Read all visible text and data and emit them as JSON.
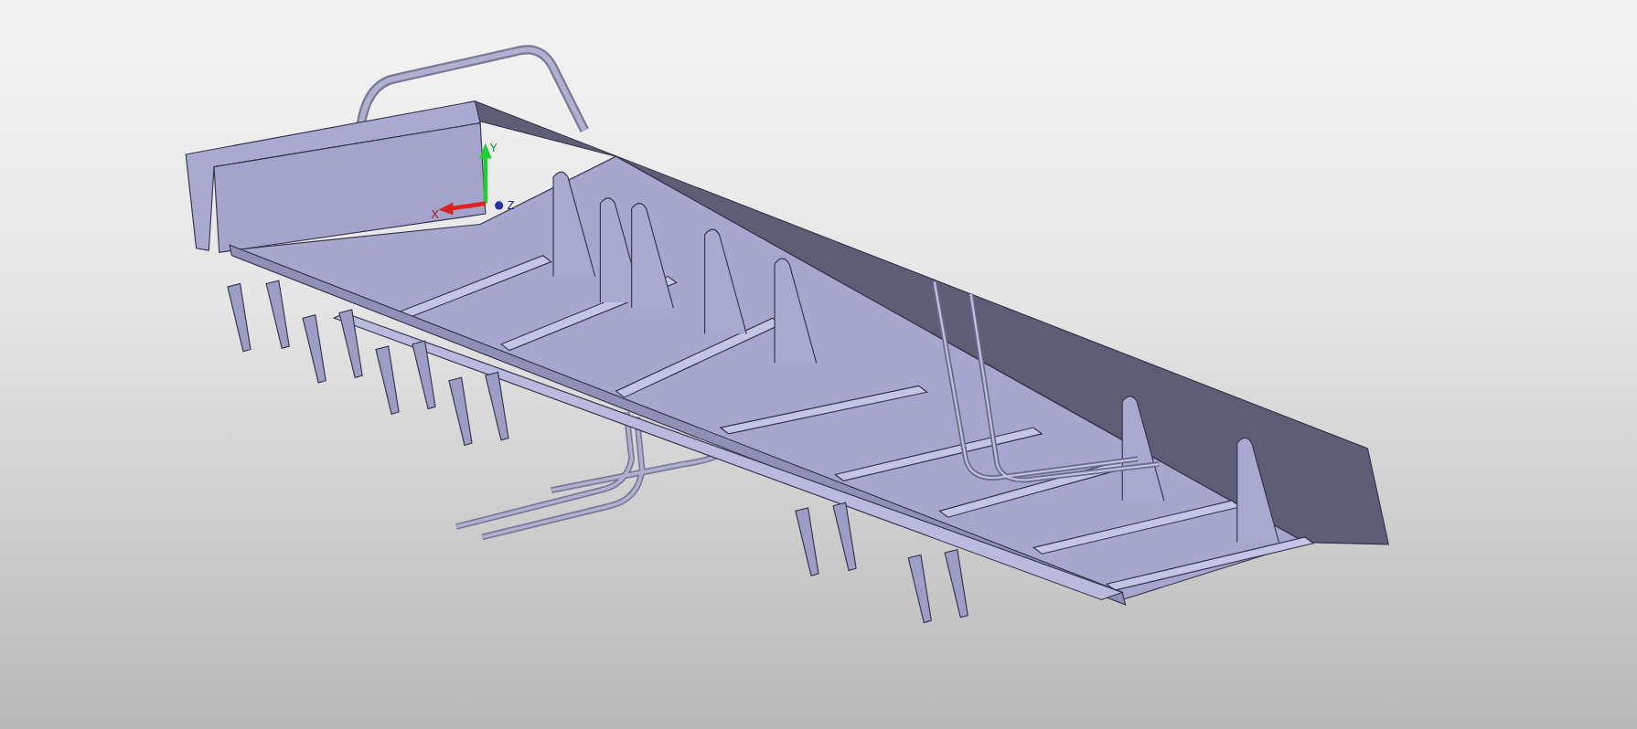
{
  "viewport": {
    "triad": {
      "x_label": "X",
      "y_label": "Y",
      "z_label": "Z"
    }
  }
}
